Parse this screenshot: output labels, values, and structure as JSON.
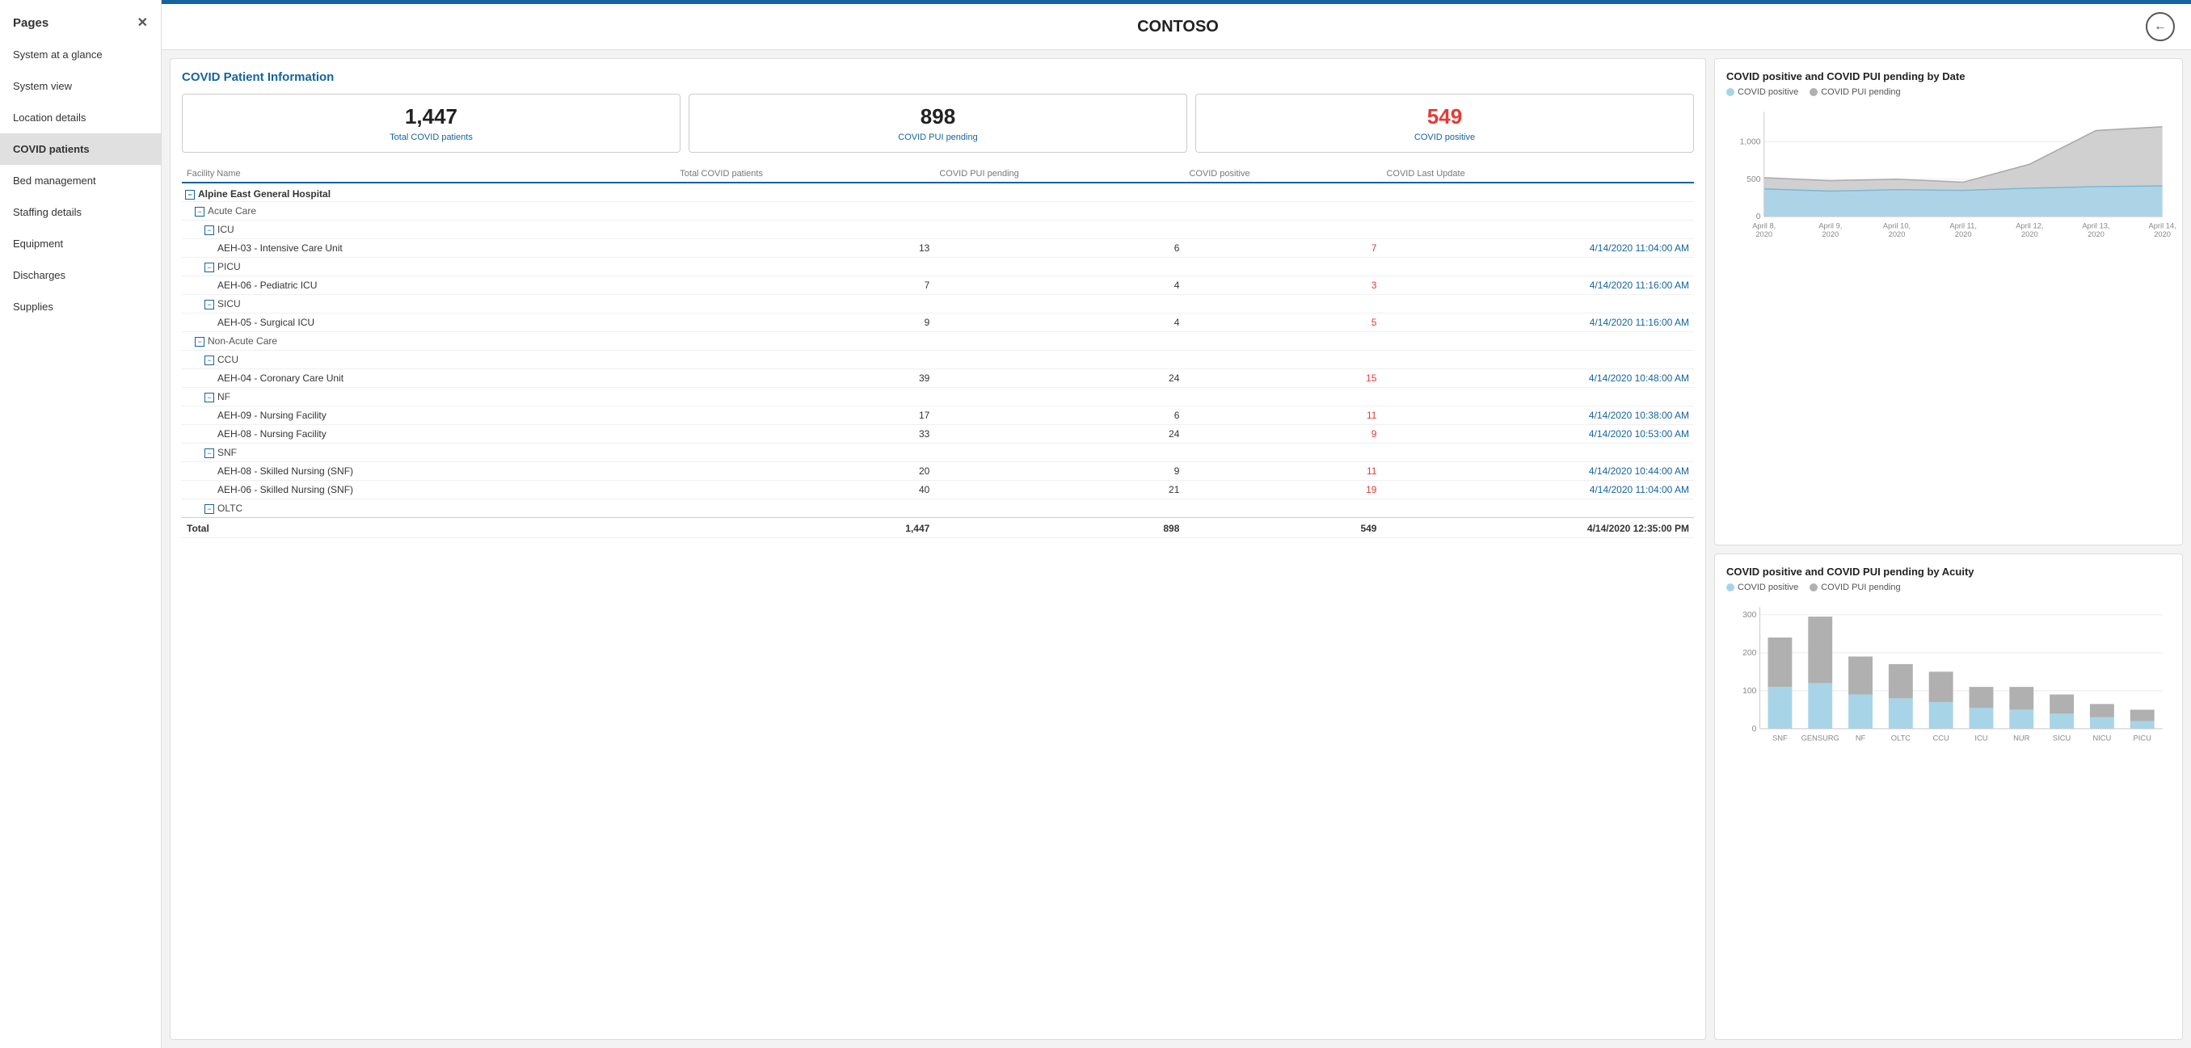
{
  "sidebar": {
    "header": "Pages",
    "items": [
      {
        "label": "System at a glance",
        "active": false
      },
      {
        "label": "System view",
        "active": false
      },
      {
        "label": "Location details",
        "active": false
      },
      {
        "label": "COVID patients",
        "active": true
      },
      {
        "label": "Bed management",
        "active": false
      },
      {
        "label": "Staffing details",
        "active": false
      },
      {
        "label": "Equipment",
        "active": false
      },
      {
        "label": "Discharges",
        "active": false
      },
      {
        "label": "Supplies",
        "active": false
      }
    ]
  },
  "header": {
    "title": "CONTOSO",
    "back_label": "←"
  },
  "covid_section": {
    "title": "COVID Patient Information",
    "kpis": [
      {
        "number": "1,447",
        "label": "Total COVID patients",
        "color": "normal"
      },
      {
        "number": "898",
        "label": "COVID PUI pending",
        "color": "normal"
      },
      {
        "number": "549",
        "label": "COVID positive",
        "color": "red"
      }
    ]
  },
  "table": {
    "columns": [
      "Facility Name",
      "Total COVID patients",
      "COVID PUI pending",
      "COVID positive",
      "COVID Last Update"
    ],
    "groups": [
      {
        "name": "Alpine East General Hospital",
        "subgroups": [
          {
            "name": "Acute Care",
            "categories": [
              {
                "name": "ICU",
                "rows": [
                  {
                    "name": "AEH-03 - Intensive Care Unit",
                    "total": 13,
                    "pui": 6,
                    "positive": 7,
                    "date": "4/14/2020 11:04:00 AM"
                  }
                ]
              },
              {
                "name": "PICU",
                "rows": [
                  {
                    "name": "AEH-06 - Pediatric ICU",
                    "total": 7,
                    "pui": 4,
                    "positive": 3,
                    "date": "4/14/2020 11:16:00 AM"
                  }
                ]
              },
              {
                "name": "SICU",
                "rows": [
                  {
                    "name": "AEH-05 - Surgical ICU",
                    "total": 9,
                    "pui": 4,
                    "positive": 5,
                    "date": "4/14/2020 11:16:00 AM"
                  }
                ]
              }
            ]
          },
          {
            "name": "Non-Acute Care",
            "categories": [
              {
                "name": "CCU",
                "rows": [
                  {
                    "name": "AEH-04 - Coronary Care Unit",
                    "total": 39,
                    "pui": 24,
                    "positive": 15,
                    "date": "4/14/2020 10:48:00 AM"
                  }
                ]
              },
              {
                "name": "NF",
                "rows": [
                  {
                    "name": "AEH-09 - Nursing Facility",
                    "total": 17,
                    "pui": 6,
                    "positive": 11,
                    "date": "4/14/2020 10:38:00 AM"
                  },
                  {
                    "name": "AEH-08 - Nursing Facility",
                    "total": 33,
                    "pui": 24,
                    "positive": 9,
                    "date": "4/14/2020 10:53:00 AM"
                  }
                ]
              },
              {
                "name": "SNF",
                "rows": [
                  {
                    "name": "AEH-08 - Skilled Nursing (SNF)",
                    "total": 20,
                    "pui": 9,
                    "positive": 11,
                    "date": "4/14/2020 10:44:00 AM"
                  },
                  {
                    "name": "AEH-06 - Skilled Nursing (SNF)",
                    "total": 40,
                    "pui": 21,
                    "positive": 19,
                    "date": "4/14/2020 11:04:00 AM"
                  }
                ]
              },
              {
                "name": "OLTC",
                "rows": []
              }
            ]
          }
        ]
      }
    ],
    "total_row": {
      "label": "Total",
      "total": "1,447",
      "pui": 898,
      "positive": 549,
      "date": "4/14/2020 12:35:00 PM"
    }
  },
  "chart1": {
    "title": "COVID positive and COVID PUI pending by Date",
    "legend": [
      {
        "label": "COVID positive",
        "color": "#a8d4e8"
      },
      {
        "label": "COVID PUI pending",
        "color": "#b0b0b0"
      }
    ],
    "x_labels": [
      "April 8, 2020",
      "April 9, 2020",
      "April 10, 2020",
      "April 11, 2020",
      "April 12, 2020",
      "April 13, 2020",
      "April 14, 2020"
    ],
    "y_labels": [
      "0",
      "500",
      "1,000"
    ],
    "positive_data": [
      370,
      340,
      360,
      350,
      380,
      400,
      410
    ],
    "pui_data": [
      520,
      480,
      500,
      460,
      700,
      1150,
      1200
    ]
  },
  "chart2": {
    "title": "COVID positive and COVID PUI pending by Acuity",
    "legend": [
      {
        "label": "COVID positive",
        "color": "#a8d4e8"
      },
      {
        "label": "COVID PUI pending",
        "color": "#b0b0b0"
      }
    ],
    "x_labels": [
      "SNF",
      "GENSURG",
      "NF",
      "OLTC",
      "CCU",
      "ICU",
      "NUR",
      "SICU",
      "NICU",
      "PICU"
    ],
    "y_labels": [
      "0",
      "100",
      "200",
      "300"
    ],
    "positive_data": [
      110,
      120,
      90,
      80,
      70,
      55,
      50,
      40,
      30,
      20
    ],
    "pui_data": [
      130,
      175,
      100,
      90,
      80,
      55,
      60,
      50,
      35,
      30
    ]
  }
}
